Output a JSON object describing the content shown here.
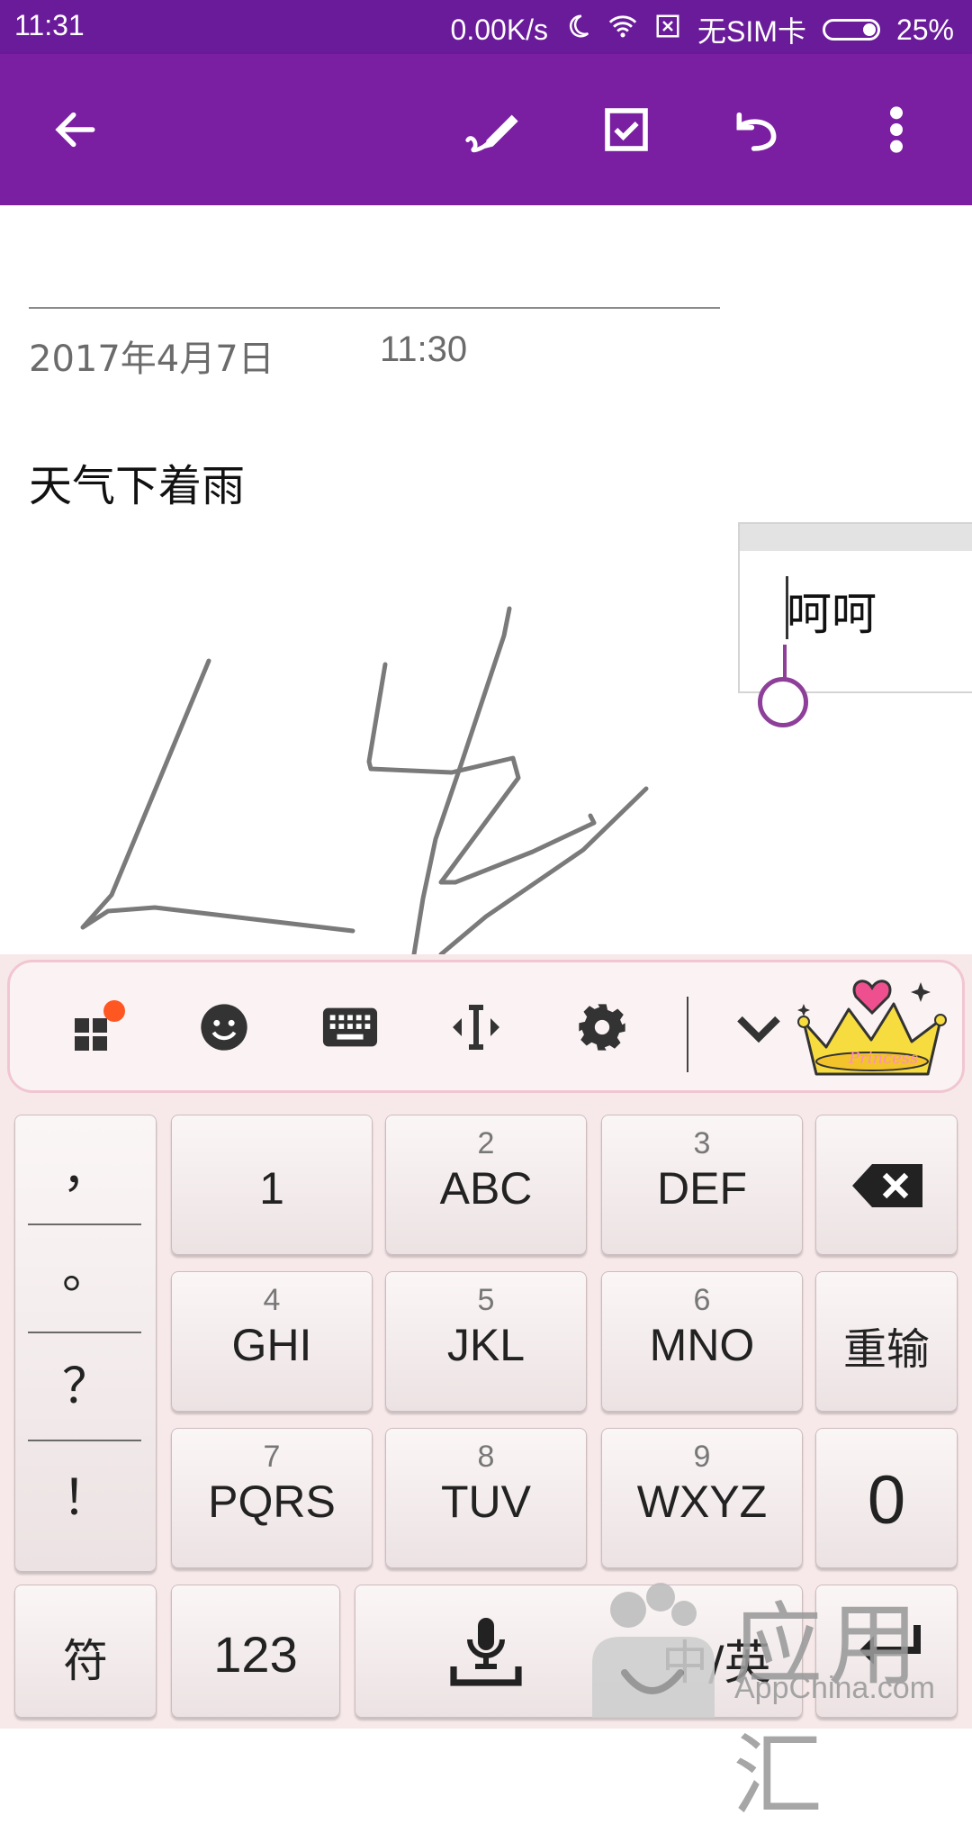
{
  "status_bar": {
    "time": "11:31",
    "speed": "0.00K/s",
    "sim": "无SIM卡",
    "battery": "25%"
  },
  "toolbar": {
    "back_icon": "back-arrow-icon",
    "pen_icon": "pen-draw-icon",
    "check_icon": "checkbox-icon",
    "undo_icon": "undo-icon",
    "more_icon": "more-vert-icon",
    "color": "#7b1fa2"
  },
  "note": {
    "date": "2017年4月7日",
    "time": "11:30",
    "body": "天气下着雨",
    "textbox": "呵呵"
  },
  "keyboard": {
    "toolbar_icons": [
      "apps-grid-icon",
      "emoji-icon",
      "keyboard-icon",
      "cursor-move-icon",
      "settings-gear-icon",
      "chevron-down-icon",
      "princess-crown-icon"
    ],
    "punctuation": [
      "，",
      "。",
      "？",
      "！"
    ],
    "keys": {
      "k1": "1",
      "k2_num": "2",
      "k2": "ABC",
      "k3_num": "3",
      "k3": "DEF",
      "k4_num": "4",
      "k4": "GHI",
      "k5_num": "5",
      "k5": "JKL",
      "k6_num": "6",
      "k6": "MNO",
      "k7_num": "7",
      "k7": "PQRS",
      "k8_num": "8",
      "k8": "TUV",
      "k9_num": "9",
      "k9": "WXYZ",
      "reinput": "重输",
      "zero": "0",
      "symbols": "符",
      "numbers": "123",
      "lang": "中/英"
    }
  },
  "watermark": {
    "cn": "应用汇",
    "en": "AppChina.com"
  }
}
